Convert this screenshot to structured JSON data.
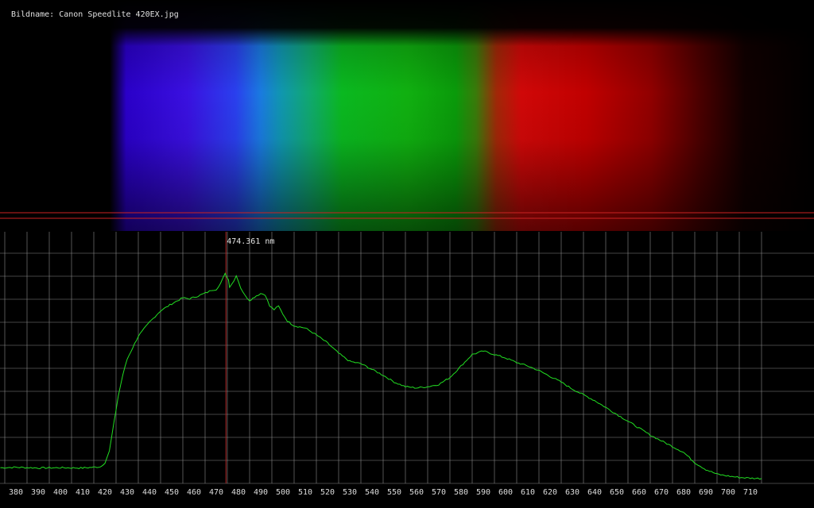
{
  "image": {
    "title_label": "Bildname:",
    "title_value": "Canon Speedlite 420EX.jpg"
  },
  "cursor": {
    "wavelength": 474.361,
    "label": "474.361 nm"
  },
  "colors": {
    "grid": "#8a8a8a",
    "curve": "#22dd22",
    "cursor": "#aa2222",
    "selection_lines": "#cc2222",
    "background": "#000000"
  },
  "chart_data": {
    "type": "line",
    "title": "",
    "xlabel": "",
    "ylabel": "",
    "xlim": [
      373,
      715
    ],
    "ylim": [
      0,
      100
    ],
    "grid": true,
    "x_ticks": [
      380,
      390,
      400,
      410,
      420,
      430,
      440,
      450,
      460,
      470,
      480,
      490,
      500,
      510,
      520,
      530,
      540,
      550,
      560,
      570,
      580,
      590,
      600,
      610,
      620,
      630,
      640,
      650,
      660,
      670,
      680,
      690,
      700,
      710
    ],
    "series": [
      {
        "name": "",
        "points": [
          [
            373,
            6.8
          ],
          [
            380,
            7.0
          ],
          [
            390,
            6.7
          ],
          [
            400,
            6.8
          ],
          [
            410,
            6.7
          ],
          [
            418,
            7.2
          ],
          [
            420,
            9.0
          ],
          [
            422,
            14
          ],
          [
            424,
            26
          ],
          [
            426,
            38
          ],
          [
            428,
            47
          ],
          [
            430,
            54
          ],
          [
            435,
            64
          ],
          [
            440,
            70
          ],
          [
            445,
            75
          ],
          [
            450,
            78
          ],
          [
            455,
            80.6
          ],
          [
            458,
            80.2
          ],
          [
            462,
            81.5
          ],
          [
            466,
            83
          ],
          [
            468,
            84
          ],
          [
            470,
            84.3
          ],
          [
            472,
            87
          ],
          [
            474,
            91
          ],
          [
            475.5,
            88.5
          ],
          [
            476,
            85.5
          ],
          [
            478,
            88
          ],
          [
            479,
            90.5
          ],
          [
            481,
            85
          ],
          [
            483,
            81.5
          ],
          [
            485,
            79.5
          ],
          [
            488,
            81.5
          ],
          [
            490,
            82.5
          ],
          [
            492,
            82
          ],
          [
            494,
            77
          ],
          [
            496,
            75.5
          ],
          [
            498,
            77
          ],
          [
            500,
            73.5
          ],
          [
            502,
            70.5
          ],
          [
            505,
            68.5
          ],
          [
            510,
            67.5
          ],
          [
            515,
            64.5
          ],
          [
            520,
            61
          ],
          [
            525,
            56.5
          ],
          [
            530,
            53
          ],
          [
            535,
            52
          ],
          [
            540,
            49.5
          ],
          [
            545,
            47
          ],
          [
            550,
            44
          ],
          [
            555,
            42
          ],
          [
            560,
            41.5
          ],
          [
            565,
            42
          ],
          [
            570,
            43
          ],
          [
            575,
            46
          ],
          [
            580,
            51
          ],
          [
            585,
            56
          ],
          [
            590,
            57.5
          ],
          [
            595,
            56
          ],
          [
            600,
            54.5
          ],
          [
            605,
            52.5
          ],
          [
            610,
            51
          ],
          [
            615,
            49
          ],
          [
            620,
            46.5
          ],
          [
            625,
            44
          ],
          [
            630,
            41
          ],
          [
            635,
            38.5
          ],
          [
            640,
            36
          ],
          [
            645,
            33
          ],
          [
            650,
            30
          ],
          [
            655,
            27
          ],
          [
            660,
            24
          ],
          [
            665,
            21
          ],
          [
            670,
            18.5
          ],
          [
            675,
            16
          ],
          [
            680,
            13.5
          ],
          [
            685,
            9
          ],
          [
            690,
            6
          ],
          [
            695,
            4
          ],
          [
            700,
            3.2
          ],
          [
            705,
            2.6
          ],
          [
            710,
            2.3
          ],
          [
            715,
            2.1
          ]
        ]
      }
    ]
  }
}
